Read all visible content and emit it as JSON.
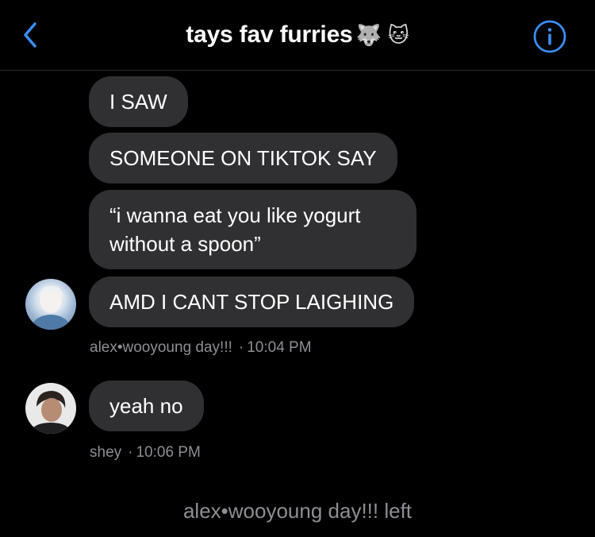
{
  "header": {
    "title": "tays fav furries",
    "title_emoji": "🐺 🐱",
    "back_icon": "chevron-left-icon",
    "info_icon": "info-circle-icon"
  },
  "messages": {
    "group1": {
      "bubbles": [
        "I SAW",
        "SOMEONE ON TIKTOK SAY",
        "“i wanna eat you like yogurt without a spoon”",
        "AMD I CANT STOP LAIGHING"
      ],
      "sender": "alex•wooyoung day!!!",
      "time": "10:04 PM"
    },
    "group2": {
      "bubbles": [
        "yeah no"
      ],
      "sender": "shey",
      "time": "10:06 PM"
    }
  },
  "system_message": "alex•wooyoung day!!! left",
  "colors": {
    "background": "#000000",
    "bubble": "#303033",
    "accent": "#3a8ef6",
    "meta_text": "#8e8e93"
  }
}
